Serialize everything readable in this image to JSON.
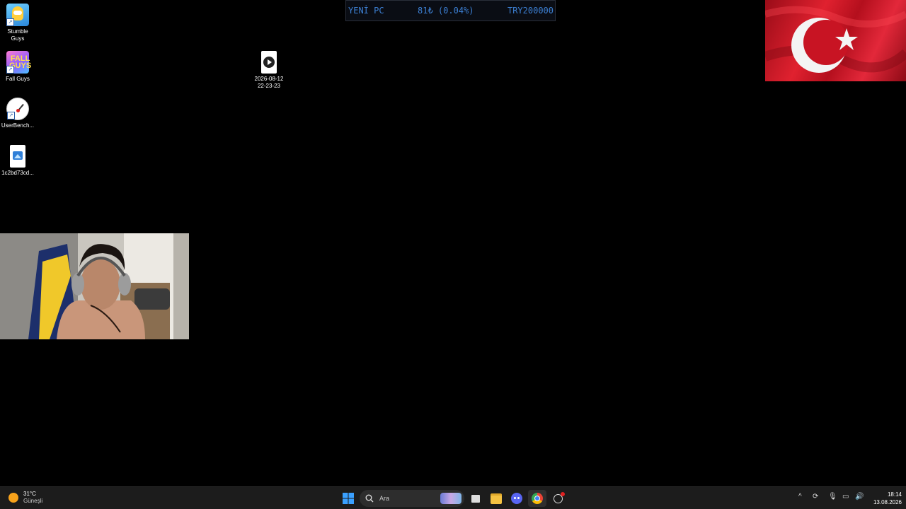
{
  "desktop": {
    "icons": [
      {
        "label_line1": "Stumble",
        "label_line2": "Guys",
        "icon": "stumble-guys-icon"
      },
      {
        "label_line1": "Fall Guys",
        "label_line2": "",
        "icon": "fall-guys-icon"
      },
      {
        "label_line1": "UserBench...",
        "label_line2": "",
        "icon": "userbenchmark-icon"
      },
      {
        "label_line1": "1c2bd73cd...",
        "label_line2": "",
        "icon": "image-file-icon"
      }
    ],
    "video_file": {
      "label_line1": "2026-08-12",
      "label_line2": "22-23-23",
      "icon": "video-file-icon"
    }
  },
  "ticker": {
    "name": "YENİ PC",
    "change": "81₺ (0.04%)",
    "goal": "TRY200000",
    "color": "#3c7fd2"
  },
  "taskbar": {
    "weather_temp": "31°C",
    "weather_desc": "Güneşli",
    "search_placeholder": "Ara",
    "time": "18:14",
    "date": "13.08.2026",
    "apps": [
      "windows-start-icon",
      "search-icon",
      "task-view-icon",
      "file-explorer-icon",
      "discord-icon",
      "chrome-icon",
      "snipping-icon"
    ]
  }
}
